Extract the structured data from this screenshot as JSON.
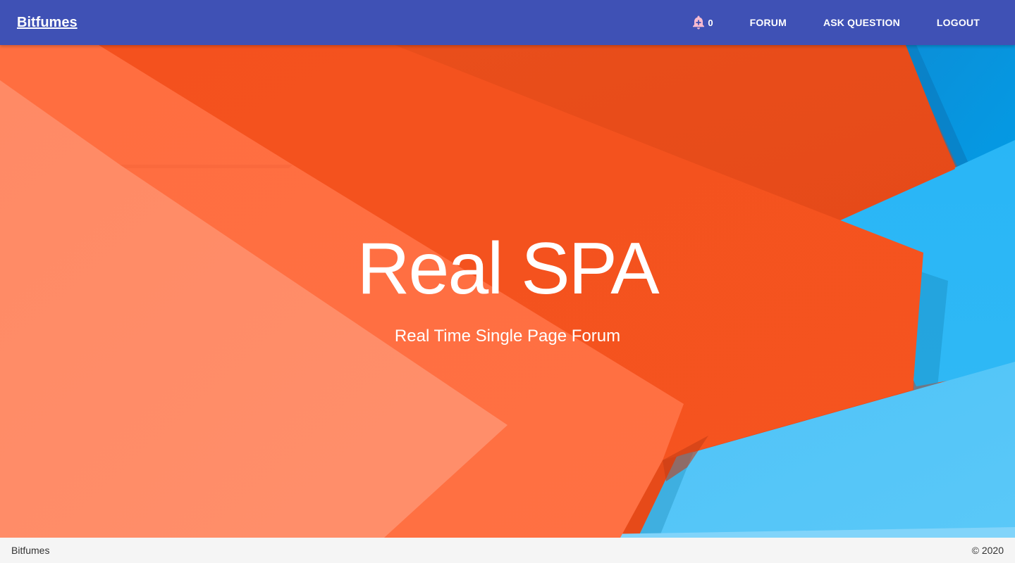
{
  "toolbar": {
    "brand": "Bitfumes",
    "notification_icon": "bell-plus-icon",
    "notification_count": "0",
    "nav": [
      {
        "label": "Forum"
      },
      {
        "label": "Ask Question"
      },
      {
        "label": "Logout"
      }
    ]
  },
  "hero": {
    "title": "Real SPA",
    "subtitle": "Real Time Single Page Forum"
  },
  "footer": {
    "left": "Bitfumes",
    "right": "© 2020"
  },
  "colors": {
    "toolbar": "#3f51b5",
    "accent_orange": "#f4511e",
    "accent_blue": "#29b6f6",
    "bell": "#f8bbd0"
  }
}
